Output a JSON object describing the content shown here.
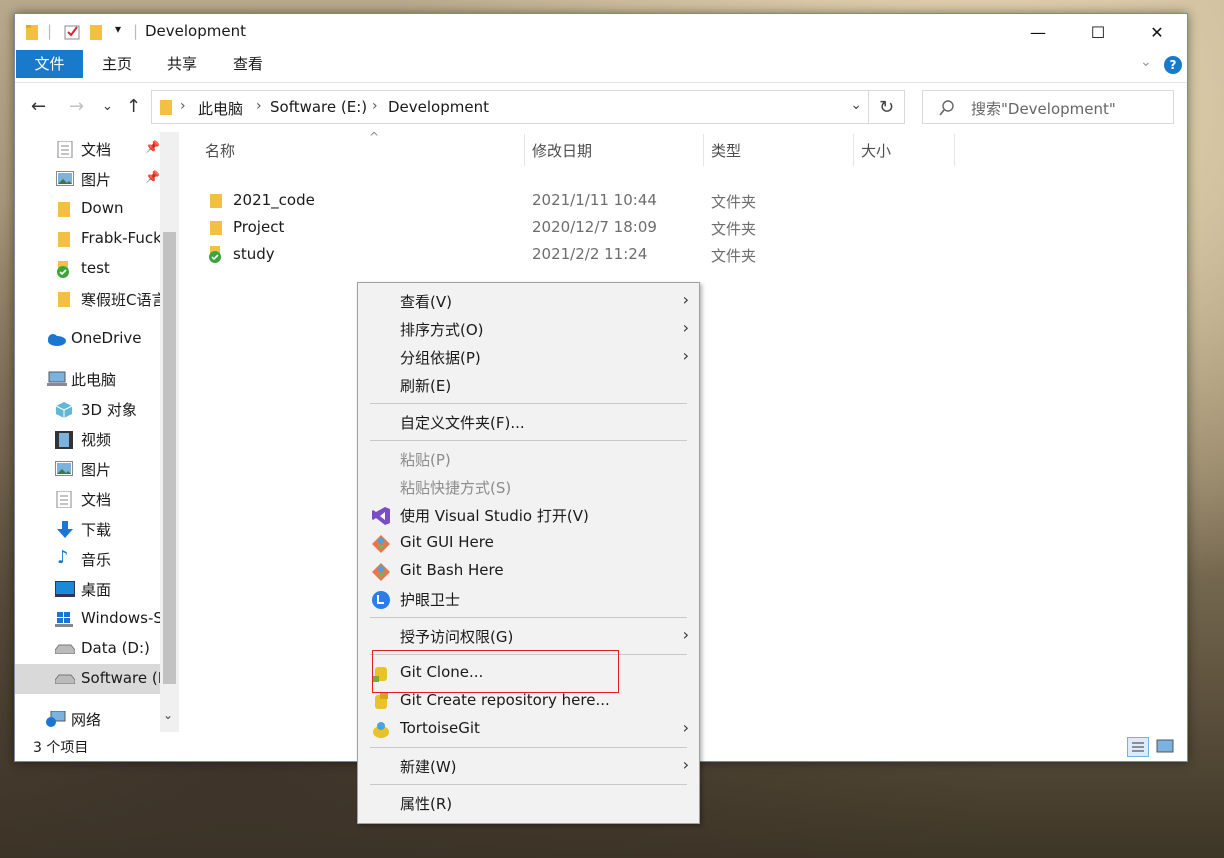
{
  "window": {
    "title": "Development"
  },
  "ribbon": {
    "tabs": [
      "文件",
      "主页",
      "共享",
      "查看"
    ]
  },
  "address": {
    "crumbs": [
      "此电脑",
      "Software (E:)",
      "Development"
    ],
    "search_placeholder": "搜索\"Development\""
  },
  "sidebar": {
    "items": [
      {
        "label": "文档",
        "icon": "document-icon",
        "pinned": true
      },
      {
        "label": "图片",
        "icon": "picture-icon",
        "pinned": true
      },
      {
        "label": "Down",
        "icon": "folder-icon"
      },
      {
        "label": "Frabk-Fuck",
        "icon": "folder-icon"
      },
      {
        "label": "test",
        "icon": "git-folder-icon"
      },
      {
        "label": "寒假班C语言",
        "icon": "folder-icon"
      },
      {
        "label": "OneDrive",
        "icon": "cloud-icon"
      },
      {
        "label": "此电脑",
        "icon": "computer-icon"
      },
      {
        "label": "3D 对象",
        "icon": "cube-icon"
      },
      {
        "label": "视频",
        "icon": "video-icon"
      },
      {
        "label": "图片",
        "icon": "picture-icon"
      },
      {
        "label": "文档",
        "icon": "document-icon"
      },
      {
        "label": "下载",
        "icon": "download-icon"
      },
      {
        "label": "音乐",
        "icon": "music-icon"
      },
      {
        "label": "桌面",
        "icon": "desktop-icon"
      },
      {
        "label": "Windows-SSD",
        "icon": "windows-drive-icon"
      },
      {
        "label": "Data (D:)",
        "icon": "drive-icon"
      },
      {
        "label": "Software (E:)",
        "icon": "drive-icon",
        "selected": true
      },
      {
        "label": "网络",
        "icon": "network-icon"
      }
    ]
  },
  "files": {
    "columns": [
      "名称",
      "修改日期",
      "类型",
      "大小"
    ],
    "rows": [
      {
        "name": "2021_code",
        "date": "2021/1/11 10:44",
        "type": "文件夹",
        "size": ""
      },
      {
        "name": "Project",
        "date": "2020/12/7 18:09",
        "type": "文件夹",
        "size": ""
      },
      {
        "name": "study",
        "date": "2021/2/2 11:24",
        "type": "文件夹",
        "size": ""
      }
    ]
  },
  "status": {
    "count": "3 个项目"
  },
  "context_menu": {
    "items": [
      {
        "label": "查看(V)",
        "submenu": true
      },
      {
        "label": "排序方式(O)",
        "submenu": true
      },
      {
        "label": "分组依据(P)",
        "submenu": true
      },
      {
        "label": "刷新(E)"
      },
      {
        "label": "自定义文件夹(F)..."
      },
      {
        "label": "粘贴(P)",
        "disabled": true
      },
      {
        "label": "粘贴快捷方式(S)",
        "disabled": true
      },
      {
        "label": "使用 Visual Studio 打开(V)",
        "icon": "visual-studio-icon"
      },
      {
        "label": "Git GUI Here",
        "icon": "git-icon"
      },
      {
        "label": "Git Bash Here",
        "icon": "git-icon"
      },
      {
        "label": "护眼卫士",
        "icon": "eye-guard-icon"
      },
      {
        "label": "授予访问权限(G)",
        "submenu": true
      },
      {
        "label": "Git Clone...",
        "icon": "tortoisegit-clone-icon"
      },
      {
        "label": "Git Create repository here...",
        "icon": "tortoisegit-create-icon"
      },
      {
        "label": "TortoiseGit",
        "icon": "tortoisegit-icon",
        "submenu": true
      },
      {
        "label": "新建(W)",
        "submenu": true
      },
      {
        "label": "属性(R)"
      }
    ]
  },
  "colors": {
    "accent": "#1979ca",
    "highlight_box": "#e02020",
    "folder": "#f3c043"
  }
}
